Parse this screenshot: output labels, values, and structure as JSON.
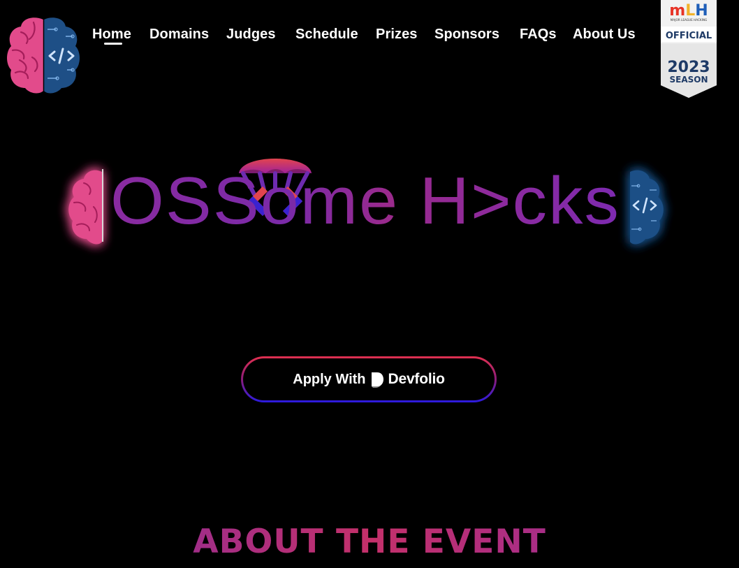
{
  "nav": {
    "items": [
      {
        "label": "Home",
        "active": true
      },
      {
        "label": "Domains",
        "active": false
      },
      {
        "label": "Judges",
        "active": false
      },
      {
        "label": "Schedule",
        "active": false
      },
      {
        "label": "Prizes",
        "active": false
      },
      {
        "label": "Sponsors",
        "active": false
      },
      {
        "label": "FAQs",
        "active": false
      },
      {
        "label": "About Us",
        "active": false
      }
    ]
  },
  "mlh_badge": {
    "brand": "MLH",
    "subtitle": "MAJOR LEAGUE HACKING",
    "official": "OFFICIAL",
    "year": "2023",
    "season": "SEASON"
  },
  "hero": {
    "title": "OSSome H>cks"
  },
  "apply": {
    "label": "Apply With",
    "brand": "Devfolio"
  },
  "about": {
    "heading": "ABOUT THE EVENT"
  },
  "colors": {
    "pink": "#e24b8b",
    "blue": "#1e4f86",
    "accent_red": "#e0304f",
    "accent_purple": "#7a2aa8",
    "accent_blue": "#2a1be0"
  },
  "icons": [
    "brain-code-logo-icon",
    "brain-left-icon",
    "brain-right-icon",
    "parachute-icon",
    "devfolio-icon"
  ]
}
